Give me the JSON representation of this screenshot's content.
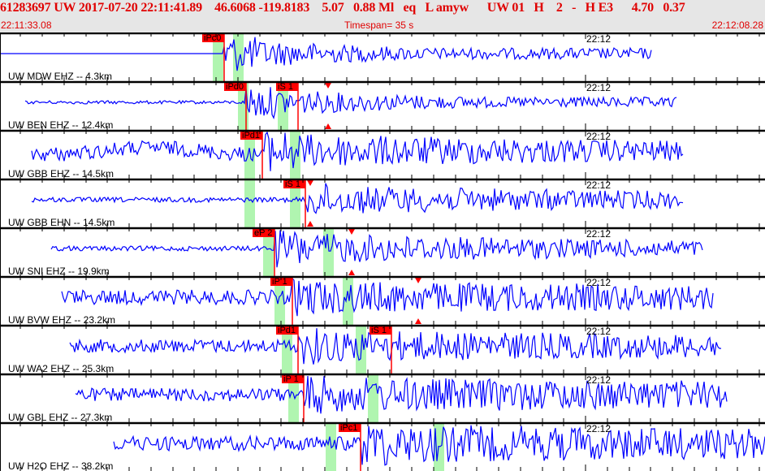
{
  "header": {
    "event_line": "61283697 UW 2017-07-20 22:11:41.89    46.6068 -119.8183    5.07   0.88 Ml   eq   L amyw      UW 01   H    2   -   H E3      4.70   0.37",
    "start_time": "22:11:33.08",
    "timespan": "Timespan=  35 s",
    "end_time": "22:12:08.28"
  },
  "minute_label": "22:12",
  "colors": {
    "trace": "#0000ff",
    "pick": "#ff0000",
    "window": "#b0f5b0",
    "header_text": "#e00000"
  },
  "traces": [
    {
      "label": "UW MDW EHZ -- 4.3km",
      "picks": [
        {
          "label": "iPc0"
        }
      ]
    },
    {
      "label": "UW BEN EHZ -- 12.4km",
      "picks": [
        {
          "label": "iPd0"
        },
        {
          "label": "iS 1"
        }
      ]
    },
    {
      "label": "UW GBB EHZ -- 14.5km",
      "picks": [
        {
          "label": "iPd1"
        }
      ]
    },
    {
      "label": "UW GBB EHN -- 14.5km",
      "picks": [
        {
          "label": "iS 1"
        }
      ]
    },
    {
      "label": "UW SNI EHZ -- 19.9km",
      "picks": [
        {
          "label": "eP 2"
        }
      ]
    },
    {
      "label": "UW BVW EHZ -- 23.2km",
      "picks": [
        {
          "label": "iP 1"
        }
      ]
    },
    {
      "label": "UW WA2 EHZ -- 25.3km",
      "picks": [
        {
          "label": "iPd1"
        },
        {
          "label": "iS 1"
        }
      ]
    },
    {
      "label": "UW GBL EHZ -- 27.3km",
      "picks": [
        {
          "label": "iP 1"
        }
      ]
    },
    {
      "label": "UW H2O EHZ -- 38.2km",
      "picks": [
        {
          "label": "iPc1"
        }
      ]
    }
  ]
}
